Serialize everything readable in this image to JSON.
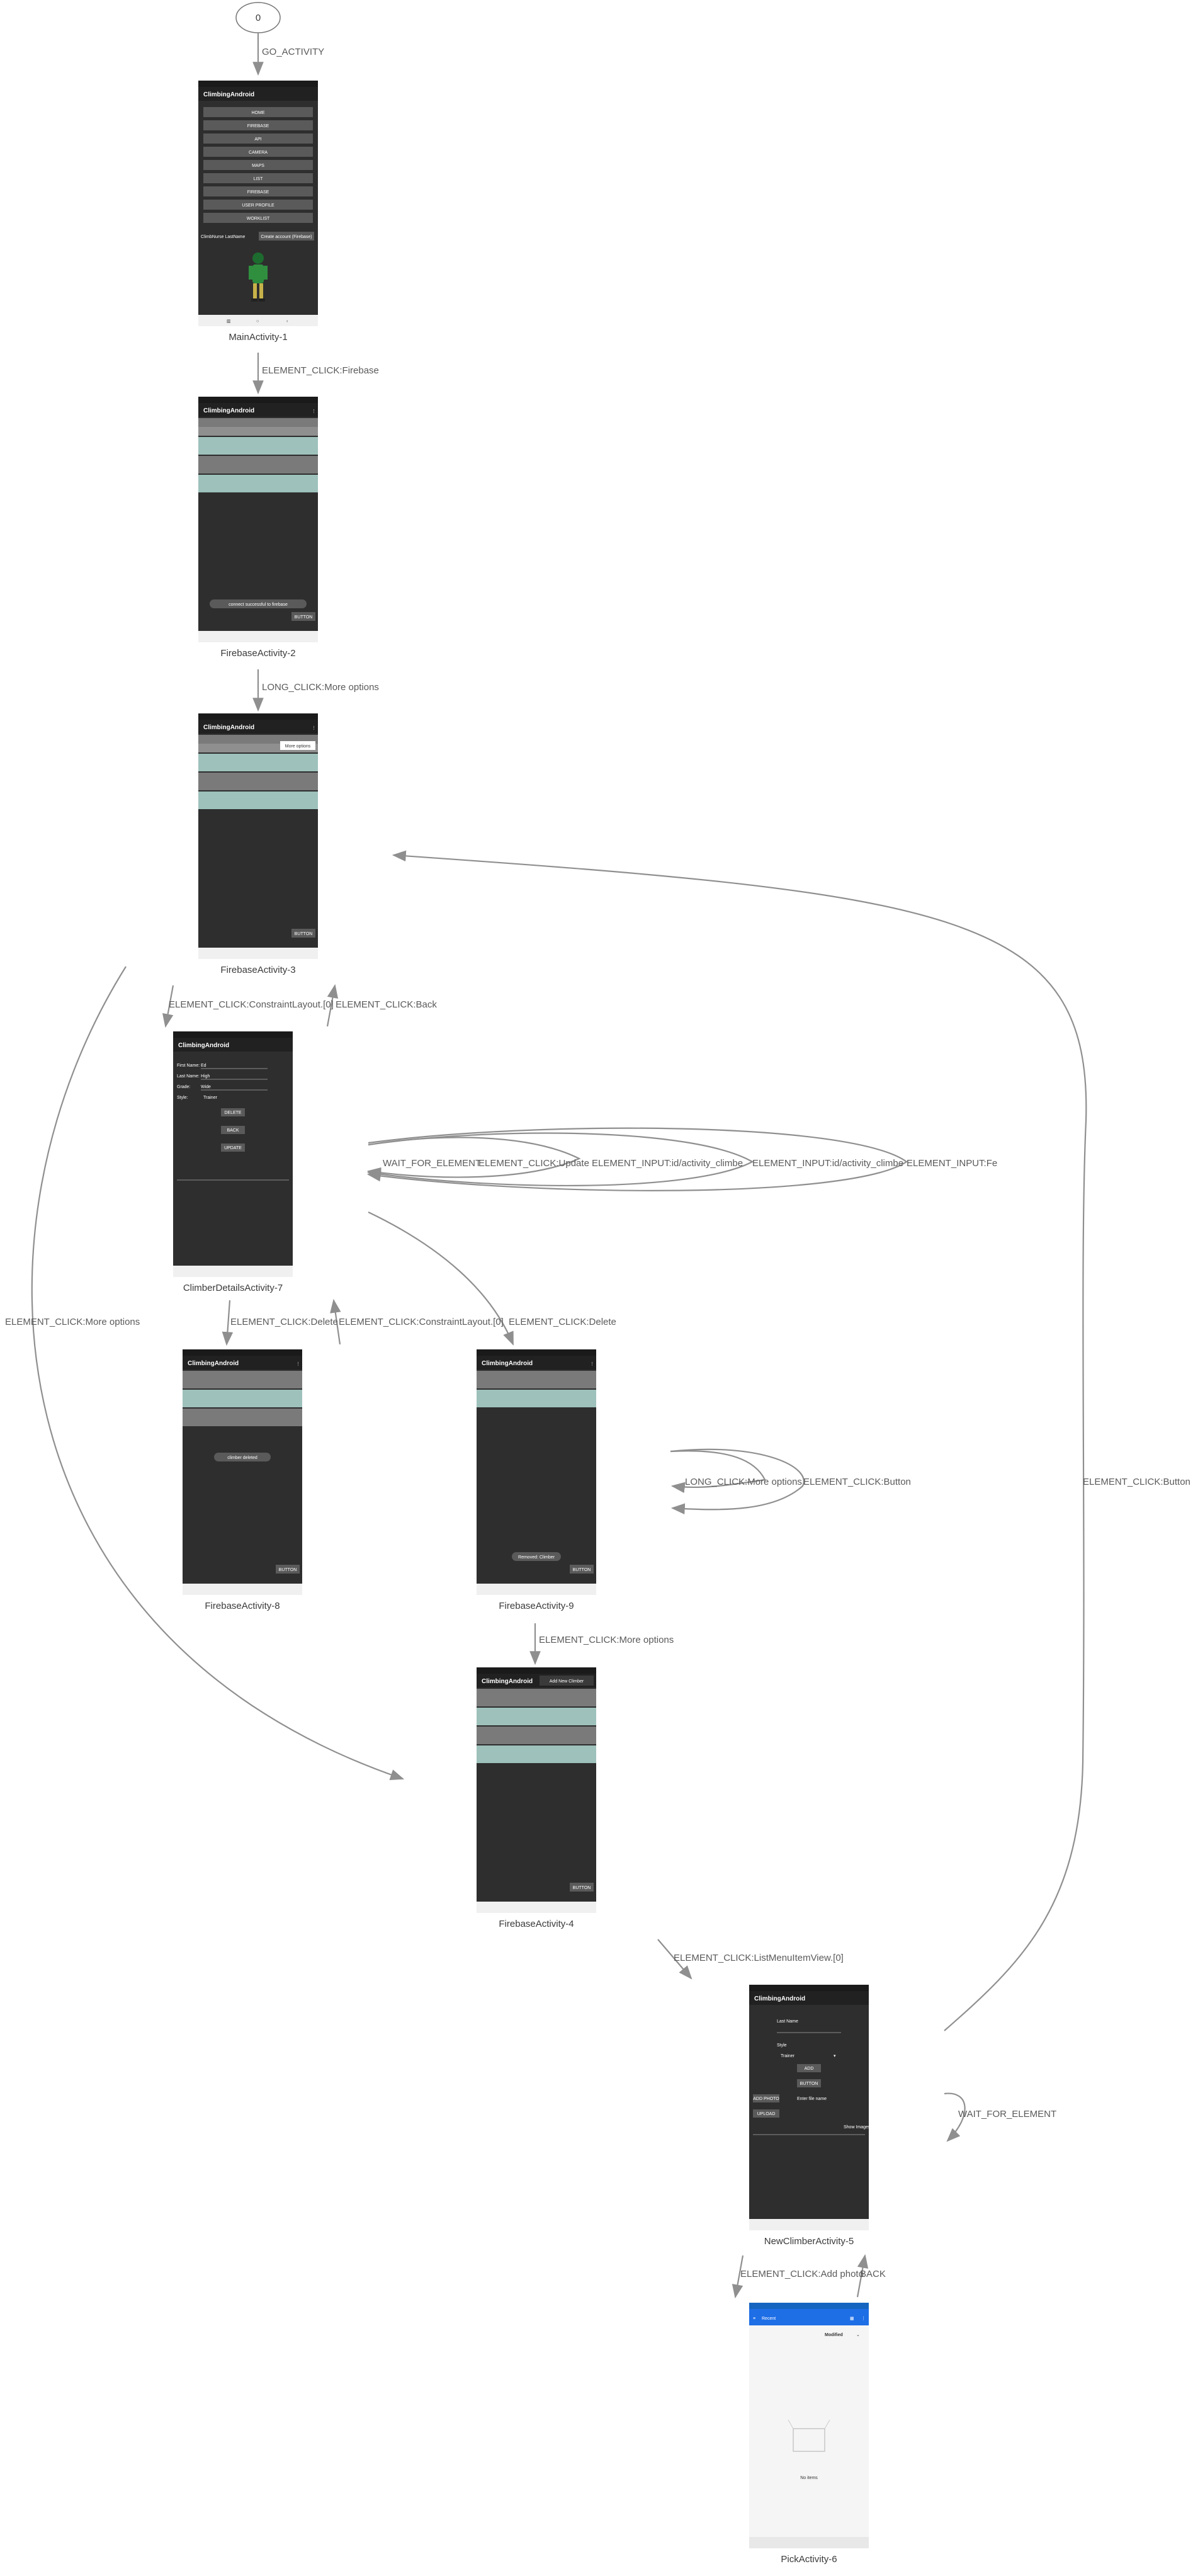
{
  "start_node": "0",
  "nodes": {
    "main": "MainActivity-1",
    "fb2": "FirebaseActivity-2",
    "fb3": "FirebaseActivity-3",
    "details7": "ClimberDetailsActivity-7",
    "fb8": "FirebaseActivity-8",
    "fb9": "FirebaseActivity-9",
    "fb4": "FirebaseActivity-4",
    "new5": "NewClimberActivity-5",
    "pick6": "PickActivity-6"
  },
  "edges": {
    "go_activity": "GO_ACTIVITY",
    "click_firebase": "ELEMENT_CLICK:Firebase",
    "long_click_more": "LONG_CLICK:More options",
    "click_constraint": "ELEMENT_CLICK:ConstraintLayout.[0]",
    "click_back": "ELEMENT_CLICK:Back",
    "wait_for_element_a": "WAIT_FOR_ELEMENT",
    "click_update": "ELEMENT_CLICK:Update",
    "input_climber_a": "ELEMENT_INPUT:id/activity_climbe",
    "input_climber_b": "ELEMENT_INPUT:id/activity_climbe",
    "input_fe": "ELEMENT_INPUT:Fe",
    "click_more_left": "ELEMENT_CLICK:More options",
    "click_delete_a": "ELEMENT_CLICK:Delete",
    "click_constraint_b": "ELEMENT_CLICK:ConstraintLayout.[0]",
    "click_delete_b": "ELEMENT_CLICK:Delete",
    "long_click_more_b": "LONG_CLICK:More options",
    "click_button_a": "ELEMENT_CLICK:Button",
    "click_button_right": "ELEMENT_CLICK:Button",
    "click_more_fb9": "ELEMENT_CLICK:More options",
    "click_listmenu": "ELEMENT_CLICK:ListMenuItemView.[0]",
    "wait_for_element_b": "WAIT_FOR_ELEMENT",
    "click_add_photo": "ELEMENT_CLICK:Add photo",
    "back": "BACK"
  },
  "screens": {
    "app_title": "ClimbingAndroid",
    "main_menu": [
      "HOME",
      "FIREBASE",
      "API",
      "CAMERA",
      "MAPS",
      "LIST",
      "FIREBASE",
      "USER PROFILE",
      "WORKLIST"
    ],
    "main_input_placeholder": "ClimbNurse LastName",
    "main_input_button": "Create account (Firebase)",
    "button_label": "BUTTON",
    "toast_connect": "connect successful to firebase",
    "toast_deleted": "climber deleted",
    "toast_remove": "Removed: Climber",
    "popup_more": "More options",
    "popup_fb4": "Add New Climber",
    "details_fields": [
      "First Name:",
      "Last Name:",
      "Grade:",
      "Style:"
    ],
    "details_values": [
      "Ed",
      "High",
      "Wide",
      "Trainer"
    ],
    "details_buttons": [
      "DELETE",
      "BACK",
      "UPDATE"
    ],
    "new_fields": [
      "Last Name",
      "Style",
      "Grade"
    ],
    "new_values": [
      "Trainer",
      "ADD",
      "BUTTON"
    ],
    "new_buttons": [
      "ADD PHOTO",
      "UPLOAD"
    ],
    "new_enter_name": "Enter file name",
    "new_show_images": "Show Images",
    "pick_header": "Recent",
    "pick_sort": "Modified",
    "pick_empty": "No items"
  }
}
